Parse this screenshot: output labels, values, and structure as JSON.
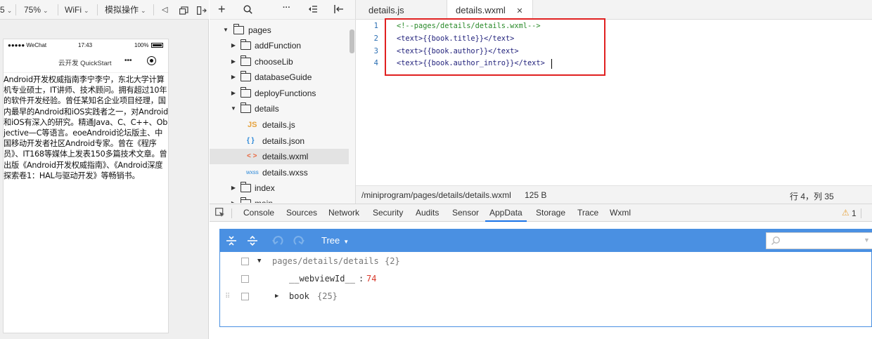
{
  "sim_toolbar": {
    "partial": "5",
    "zoom": "75%",
    "network": "WiFi",
    "operation": "模拟操作"
  },
  "phone": {
    "status": {
      "carrier": "●●●●● WeChat",
      "time": "17:43",
      "battery": "100%"
    },
    "nav_title": "云开发 QuickStart",
    "menu_dots": "•••",
    "content": "Android开发权威指南李宁李宁，东北大学计算机专业硕士，IT讲师、技术顾问。拥有超过10年的软件开发经验。曾任某知名企业项目经理，国内最早的Android和iOS实践者之一，对Android和iOS有深入的研究。精通Java、C、C++、Objective—C等语言。eoeAndroid论坛版主、中国移动开发者社区Android专家。曾在《程序员》、IT168等媒体上发表150多篇技术文章。曾出版《Android开发权威指南》、《Android深度探索卷1：HAL与驱动开发》等畅销书。"
  },
  "tree": {
    "items": [
      {
        "label": "pages",
        "type": "folder",
        "expanded": true
      },
      {
        "label": "addFunction",
        "type": "folder",
        "expanded": false
      },
      {
        "label": "chooseLib",
        "type": "folder",
        "expanded": false
      },
      {
        "label": "databaseGuide",
        "type": "folder",
        "expanded": false
      },
      {
        "label": "deployFunctions",
        "type": "folder",
        "expanded": false
      },
      {
        "label": "details",
        "type": "folder",
        "expanded": true
      },
      {
        "label": "details.js",
        "type": "file",
        "icon_text": "JS",
        "icon_color": "#e6a23c"
      },
      {
        "label": "details.json",
        "type": "file",
        "icon_text": "{ }",
        "icon_color": "#2b88d8"
      },
      {
        "label": "details.wxml",
        "type": "file",
        "icon_text": "< >",
        "icon_color": "#e8663d",
        "selected": true
      },
      {
        "label": "details.wxss",
        "type": "file",
        "icon_text": "wxss",
        "icon_color": "#2b88d8"
      },
      {
        "label": "index",
        "type": "folder",
        "expanded": false
      },
      {
        "label": "main",
        "type": "folder",
        "expanded": false
      }
    ]
  },
  "editor": {
    "tabs": [
      {
        "label": "details.js"
      },
      {
        "label": "details.wxml",
        "close": "✕"
      }
    ],
    "lines": [
      {
        "num": "1",
        "text": "<!--pages/details/details.wxml-->",
        "comment": true
      },
      {
        "num": "2",
        "text": "<text>{{book.title}}</text>"
      },
      {
        "num": "3",
        "text": "<text>{{book.author}}</text>"
      },
      {
        "num": "4",
        "text": "<text>{{book.author_intro}}</text>"
      }
    ],
    "status": {
      "path": "/miniprogram/pages/details/details.wxml",
      "size": "125 B",
      "position": "行 4，列 35"
    }
  },
  "devtools": {
    "tabs": [
      "Console",
      "Sources",
      "Network",
      "Security",
      "Audits",
      "Sensor",
      "AppData",
      "Storage",
      "Trace",
      "Wxml"
    ],
    "active_tab": "AppData",
    "warning_count": "1",
    "view_mode": "Tree",
    "rows": [
      {
        "key": "pages/details/details",
        "meta": "{2}"
      },
      {
        "key": "__webviewId__",
        "sep": ":",
        "value": "74"
      },
      {
        "key": "book",
        "meta": "{25}"
      }
    ]
  },
  "colors": {
    "accent_blue": "#4a90e2",
    "highlight_red": "#e02020"
  }
}
